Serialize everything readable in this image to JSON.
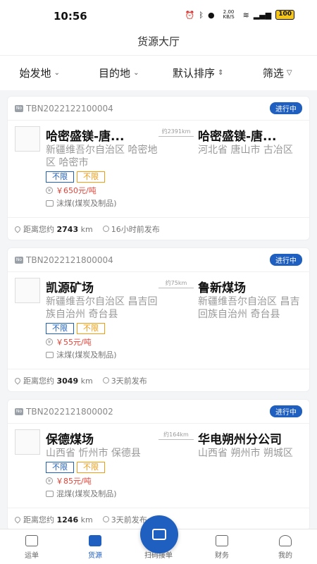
{
  "status_bar": {
    "time": "10:56",
    "net_speed": "2.00 KB/S",
    "battery": "100"
  },
  "header": {
    "title": "货源大厅"
  },
  "filters": [
    {
      "label": "始发地"
    },
    {
      "label": "目的地"
    },
    {
      "label": "默认排序"
    },
    {
      "label": "筛选"
    }
  ],
  "cards": [
    {
      "order_no": "TBN2022122100004",
      "status": "进行中",
      "from_name": "哈密盛镁-唐...",
      "from_region": "新疆维吾尔自治区 哈密地区 哈密市",
      "distance": "约2391km",
      "to_name": "哈密盛镁-唐...",
      "to_region": "河北省 唐山市 古冶区",
      "tag1": "不限",
      "tag2": "不限",
      "price": "￥650元/吨",
      "goods": "沫煤(煤炭及制品)",
      "distance_label": "距离您约",
      "distance_value": "2743",
      "distance_unit": "km",
      "posted": "16小时前发布"
    },
    {
      "order_no": "TBN2022121800004",
      "status": "进行中",
      "from_name": "凯源矿场",
      "from_region": "新疆维吾尔自治区 昌吉回族自治州 奇台县",
      "distance": "约75km",
      "to_name": "鲁新煤场",
      "to_region": "新疆维吾尔自治区 昌吉回族自治州 奇台县",
      "tag1": "不限",
      "tag2": "不限",
      "price": "￥55元/吨",
      "goods": "沫煤(煤炭及制品)",
      "distance_label": "距离您约",
      "distance_value": "3049",
      "distance_unit": "km",
      "posted": "3天前发布"
    },
    {
      "order_no": "TBN2022121800002",
      "status": "进行中",
      "from_name": "保德煤场",
      "from_region": "山西省 忻州市 保德县",
      "distance": "约164km",
      "to_name": "华电朔州分公司",
      "to_region": "山西省 朔州市 朔城区",
      "tag1": "不限",
      "tag2": "不限",
      "price": "￥85元/吨",
      "goods": "混煤(煤炭及制品)",
      "distance_label": "距离您约",
      "distance_value": "1246",
      "distance_unit": "km",
      "posted": "3天前发布"
    }
  ],
  "tabs": [
    {
      "label": "运单"
    },
    {
      "label": "货源"
    },
    {
      "label": "扫码接单"
    },
    {
      "label": "财务"
    },
    {
      "label": "我的"
    }
  ],
  "colors": {
    "accent": "#1f5fbf",
    "price": "#e0453a",
    "tag_orange": "#f39c12"
  }
}
